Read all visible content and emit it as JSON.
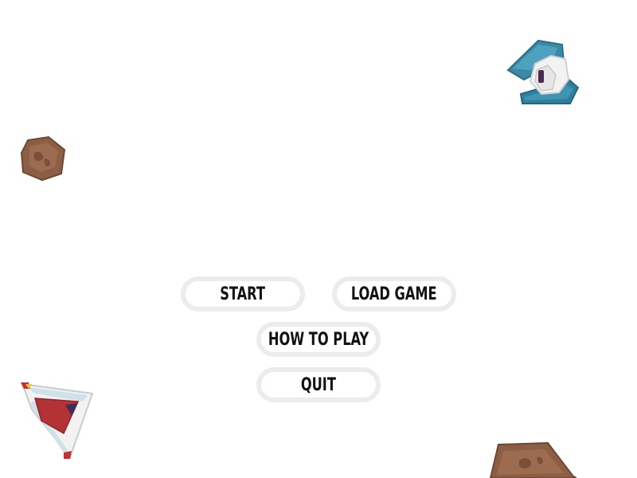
{
  "menu": {
    "start_label": "START",
    "load_label": "LOAD GAME",
    "how_to_play_label": "HOW TO PLAY",
    "quit_label": "QUIT"
  },
  "sprites": {
    "enemy_ship": "teal-enemy-ship-icon",
    "player_ship": "red-player-ship-icon",
    "asteroid_small": "brown-asteroid-icon",
    "asteroid_large": "brown-asteroid-icon"
  },
  "colors": {
    "background": "#ffffff",
    "button_border": "#ececea",
    "button_text": "#111111",
    "asteroid": "#8b5e45",
    "enemy_teal": "#3a8aa6",
    "player_red": "#b33236"
  }
}
